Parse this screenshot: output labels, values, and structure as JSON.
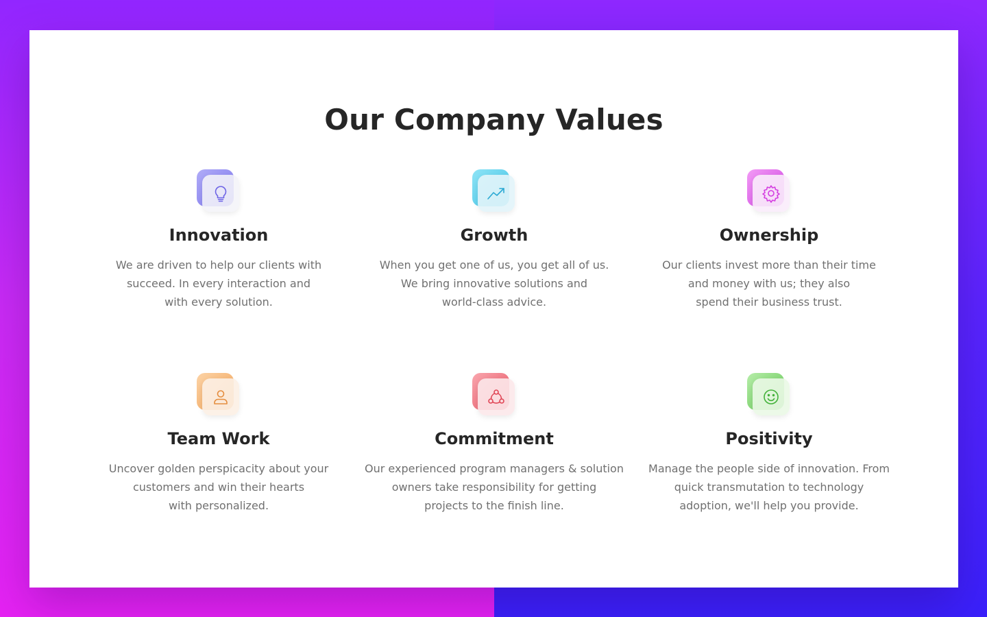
{
  "section": {
    "heading": "Our Company Values"
  },
  "values": [
    {
      "title": "Innovation",
      "description": "We are driven to help our clients with\nsucceed.  In every interaction and\nwith every solution.",
      "icon": "lightbulb-icon",
      "accent": "#8a84f0"
    },
    {
      "title": "Growth",
      "description": "When you get one of us, you get all of us.\nWe bring innovative solutions and\nworld-class advice.",
      "icon": "trending-up-icon",
      "accent": "#3cc6e4"
    },
    {
      "title": "Ownership",
      "description": "Our clients invest more than their time\nand money with us; they also\nspend their business trust.",
      "icon": "gear-icon",
      "accent": "#d84ee6"
    },
    {
      "title": "Team Work",
      "description": "Uncover golden perspicacity about your\ncustomers and win their hearts\nwith personalized.",
      "icon": "user-icon",
      "accent": "#f2a45a"
    },
    {
      "title": "Commitment",
      "description": "Our experienced program managers & solution\nowners take responsibility for getting\nprojects to the finish line.",
      "icon": "network-icon",
      "accent": "#ec5a6a"
    },
    {
      "title": "Positivity",
      "description": "Manage the people side of innovation. From\nquick transmutation to technology\nadoption, we'll help you provide.",
      "icon": "smiley-icon",
      "accent": "#62c85a"
    }
  ]
}
